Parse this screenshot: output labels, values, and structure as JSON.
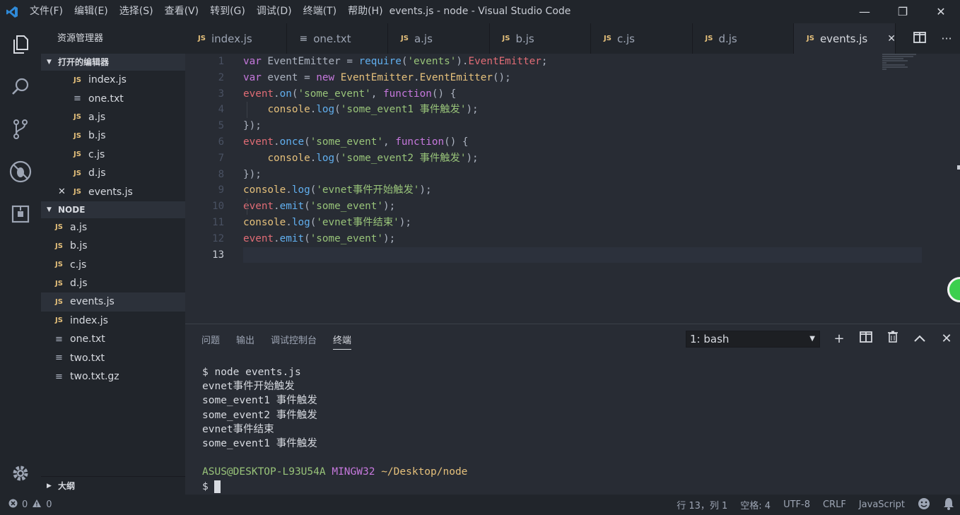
{
  "window": {
    "title": "events.js - node - Visual Studio Code",
    "menu": [
      "文件(F)",
      "编辑(E)",
      "选择(S)",
      "查看(V)",
      "转到(G)",
      "调试(D)",
      "终端(T)",
      "帮助(H)"
    ],
    "controls": {
      "minimize": "—",
      "restore": "❐",
      "close": "✕"
    }
  },
  "activity_bar": {
    "icons": [
      "explorer-icon",
      "search-icon",
      "source-control-icon",
      "debug-icon",
      "extensions-icon"
    ],
    "settings_icon": "gear-icon"
  },
  "sidebar": {
    "title": "资源管理器",
    "open_editors": {
      "label": "打开的编辑器",
      "items": [
        {
          "name": "index.js",
          "type": "js"
        },
        {
          "name": "one.txt",
          "type": "txt"
        },
        {
          "name": "a.js",
          "type": "js"
        },
        {
          "name": "b.js",
          "type": "js"
        },
        {
          "name": "c.js",
          "type": "js"
        },
        {
          "name": "d.js",
          "type": "js"
        },
        {
          "name": "events.js",
          "type": "js"
        }
      ]
    },
    "folder": {
      "label": "NODE",
      "items": [
        {
          "name": "a.js",
          "type": "js"
        },
        {
          "name": "b.js",
          "type": "js"
        },
        {
          "name": "c.js",
          "type": "js"
        },
        {
          "name": "d.js",
          "type": "js"
        },
        {
          "name": "events.js",
          "type": "js"
        },
        {
          "name": "index.js",
          "type": "js"
        },
        {
          "name": "one.txt",
          "type": "txt"
        },
        {
          "name": "two.txt",
          "type": "txt"
        },
        {
          "name": "two.txt.gz",
          "type": "txt"
        }
      ]
    },
    "outline_label": "大纲",
    "js_badge": "JS",
    "txt_icon": "≡",
    "close_glyph": "✕"
  },
  "tabs": [
    {
      "name": "index.js",
      "type": "js"
    },
    {
      "name": "one.txt",
      "type": "txt"
    },
    {
      "name": "a.js",
      "type": "js"
    },
    {
      "name": "b.js",
      "type": "js"
    },
    {
      "name": "c.js",
      "type": "js"
    },
    {
      "name": "d.js",
      "type": "js"
    },
    {
      "name": "events.js",
      "type": "js",
      "active": true
    }
  ],
  "editor": {
    "line_numbers": [
      "1",
      "2",
      "3",
      "4",
      "5",
      "6",
      "7",
      "8",
      "9",
      "10",
      "11",
      "12",
      "13"
    ],
    "current_line": 13
  },
  "panel": {
    "tabs": [
      "问题",
      "输出",
      "调试控制台",
      "终端"
    ],
    "active_tab": "终端",
    "terminal_select": "1: bash",
    "terminal_lines": [
      "$ node events.js",
      "evnet事件开始触发",
      "some_event1 事件触发",
      "some_event2 事件触发",
      "evnet事件结束",
      "some_event1 事件触发"
    ],
    "prompt": {
      "user": "ASUS@DESKTOP-L93U54A",
      "env": "MINGW32",
      "path": "~/Desktop/node",
      "symbol": "$"
    }
  },
  "status_bar": {
    "errors": "0",
    "warnings": "0",
    "position": "行 13，列 1",
    "spaces": "空格: 4",
    "encoding": "UTF-8",
    "eol": "CRLF",
    "language": "JavaScript"
  },
  "colors": {
    "background": "#282c34",
    "sidebar": "#21252b",
    "keyword": "#c678dd",
    "string": "#98c379",
    "function": "#61afef",
    "js_icon": "#e5c07b"
  }
}
